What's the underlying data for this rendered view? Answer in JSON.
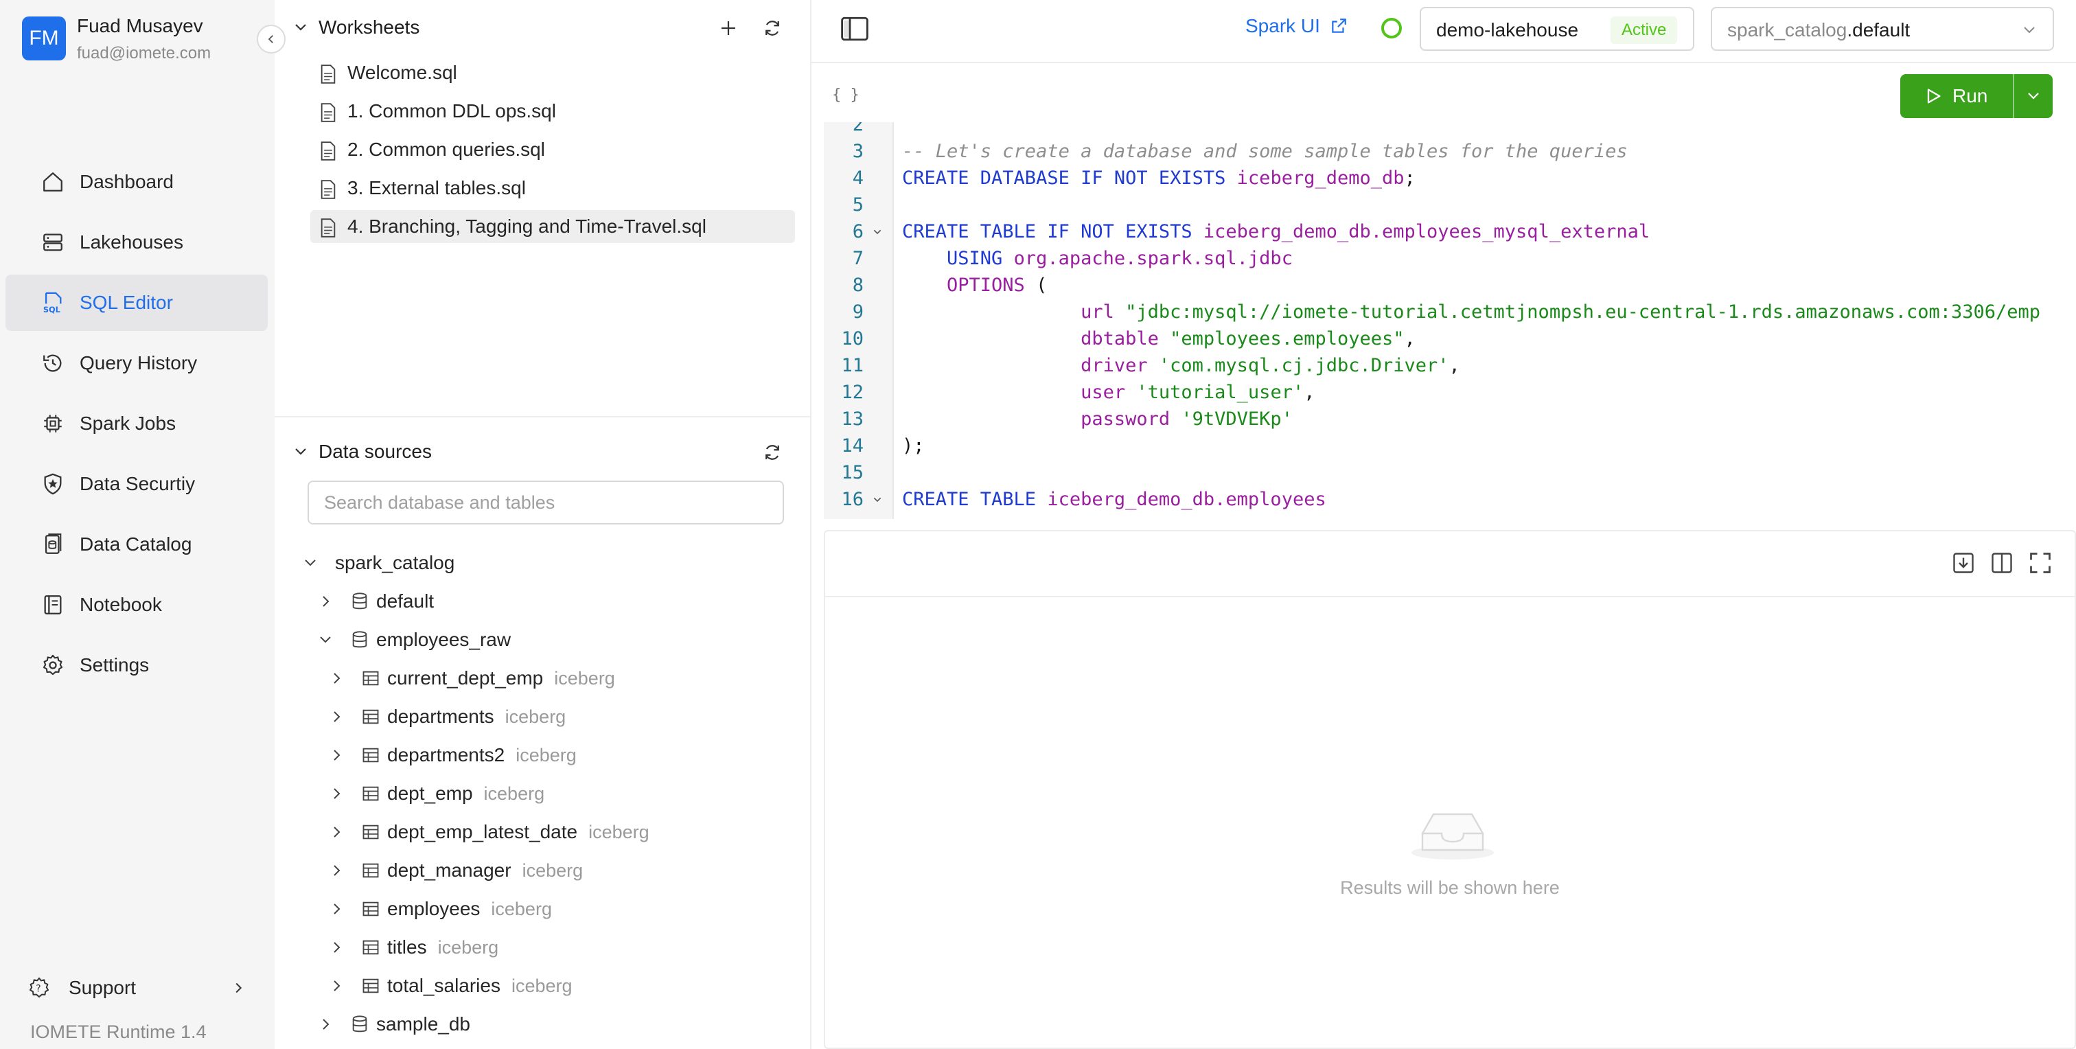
{
  "user": {
    "initials": "FM",
    "name": "Fuad Musayev",
    "email": "fuad@iomete.com"
  },
  "nav": {
    "items": [
      {
        "label": "Dashboard",
        "icon": "home-icon"
      },
      {
        "label": "Lakehouses",
        "icon": "server-icon"
      },
      {
        "label": "SQL Editor",
        "icon": "sql-icon",
        "active": true
      },
      {
        "label": "Query History",
        "icon": "history-icon"
      },
      {
        "label": "Spark Jobs",
        "icon": "chip-icon"
      },
      {
        "label": "Data Securtiy",
        "icon": "shield-icon"
      },
      {
        "label": "Data Catalog",
        "icon": "catalog-icon"
      },
      {
        "label": "Notebook",
        "icon": "notebook-icon"
      },
      {
        "label": "Settings",
        "icon": "gear-icon"
      }
    ],
    "support": "Support",
    "runtime": "IOMETE Runtime 1.4"
  },
  "worksheets": {
    "title": "Worksheets",
    "items": [
      {
        "label": "Welcome.sql"
      },
      {
        "label": "1. Common DDL ops.sql"
      },
      {
        "label": "2. Common queries.sql"
      },
      {
        "label": "3. External tables.sql"
      },
      {
        "label": "4. Branching, Tagging and Time-Travel.sql",
        "active": true
      }
    ]
  },
  "datasources": {
    "title": "Data sources",
    "search_placeholder": "Search database and tables",
    "catalog": "spark_catalog",
    "databases": [
      {
        "name": "default",
        "expanded": false
      },
      {
        "name": "employees_raw",
        "expanded": true,
        "tables": [
          {
            "name": "current_dept_emp",
            "format": "iceberg"
          },
          {
            "name": "departments",
            "format": "iceberg"
          },
          {
            "name": "departments2",
            "format": "iceberg"
          },
          {
            "name": "dept_emp",
            "format": "iceberg"
          },
          {
            "name": "dept_emp_latest_date",
            "format": "iceberg"
          },
          {
            "name": "dept_manager",
            "format": "iceberg"
          },
          {
            "name": "employees",
            "format": "iceberg"
          },
          {
            "name": "titles",
            "format": "iceberg"
          },
          {
            "name": "total_salaries",
            "format": "iceberg"
          }
        ]
      },
      {
        "name": "sample_db",
        "expanded": false
      }
    ]
  },
  "toolbar": {
    "spark_ui": "Spark UI",
    "lakehouse": "demo-lakehouse",
    "lakehouse_status": "Active",
    "catalog": "spark_catalog",
    "database": ".default",
    "braces": "{ }",
    "run_label": "Run"
  },
  "editor": {
    "lines": [
      {
        "n": "2",
        "tokens": []
      },
      {
        "n": "3",
        "tokens": [
          [
            "comment",
            "-- Let's create a database and some sample tables for the queries"
          ]
        ]
      },
      {
        "n": "4",
        "tokens": [
          [
            "kw",
            "CREATE DATABASE IF NOT EXISTS "
          ],
          [
            "id",
            "iceberg_demo_db"
          ],
          [
            "plain",
            ";"
          ]
        ]
      },
      {
        "n": "5",
        "tokens": []
      },
      {
        "n": "6",
        "fold": true,
        "tokens": [
          [
            "kw",
            "CREATE TABLE IF NOT EXISTS "
          ],
          [
            "id",
            "iceberg_demo_db.employees_mysql_external"
          ]
        ]
      },
      {
        "n": "7",
        "tokens": [
          [
            "kw",
            "    USING "
          ],
          [
            "id",
            "org.apache.spark.sql.jdbc"
          ]
        ]
      },
      {
        "n": "8",
        "tokens": [
          [
            "id",
            "    OPTIONS "
          ],
          [
            "plain",
            "("
          ]
        ]
      },
      {
        "n": "9",
        "tokens": [
          [
            "id",
            "                url "
          ],
          [
            "str",
            "\"jdbc:mysql://iomete-tutorial.cetmtjnompsh.eu-central-1.rds.amazonaws.com:3306/emp"
          ]
        ]
      },
      {
        "n": "10",
        "tokens": [
          [
            "id",
            "                dbtable "
          ],
          [
            "str",
            "\"employees.employees\""
          ],
          [
            "plain",
            ","
          ]
        ]
      },
      {
        "n": "11",
        "tokens": [
          [
            "id",
            "                driver "
          ],
          [
            "str",
            "'com.mysql.cj.jdbc.Driver'"
          ],
          [
            "plain",
            ","
          ]
        ]
      },
      {
        "n": "12",
        "tokens": [
          [
            "id",
            "                user "
          ],
          [
            "str",
            "'tutorial_user'"
          ],
          [
            "plain",
            ","
          ]
        ]
      },
      {
        "n": "13",
        "tokens": [
          [
            "id",
            "                password "
          ],
          [
            "str",
            "'9tVDVEKp'"
          ]
        ]
      },
      {
        "n": "14",
        "tokens": [
          [
            "plain",
            ");"
          ]
        ]
      },
      {
        "n": "15",
        "tokens": []
      },
      {
        "n": "16",
        "fold": true,
        "tokens": [
          [
            "kw",
            "CREATE TABLE "
          ],
          [
            "id",
            "iceberg_demo_db.employees"
          ]
        ]
      }
    ]
  },
  "results": {
    "empty_text": "Results will be shown here"
  }
}
